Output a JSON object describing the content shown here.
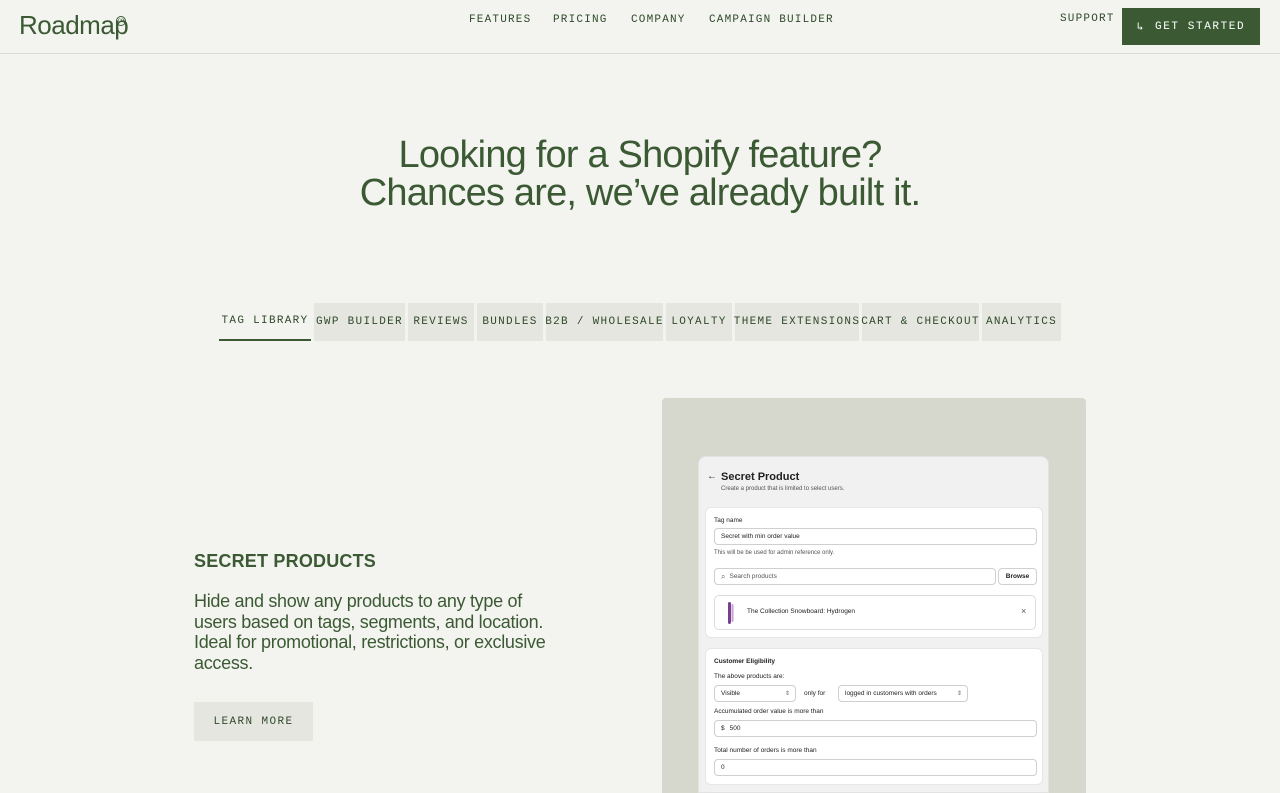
{
  "header": {
    "logo": "Roadmap",
    "logo_mark": "co",
    "nav": [
      "FEATURES",
      "PRICING",
      "COMPANY",
      "CAMPAIGN BUILDER"
    ],
    "support": "SUPPORT",
    "cta_icon": "↳",
    "cta_label": "GET STARTED"
  },
  "hero": {
    "line1": "Looking for a Shopify feature?",
    "line2": "Chances are, we’ve already built it."
  },
  "tabs": [
    "TAG LIBRARY",
    "GWP BUILDER",
    "REVIEWS",
    "BUNDLES",
    "B2B / WHOLESALE",
    "LOYALTY",
    "THEME EXTENSIONS",
    "CART & CHECKOUT",
    "ANALYTICS"
  ],
  "active_tab": "TAG LIBRARY",
  "feature": {
    "title": "SECRET PRODUCTS",
    "description": "Hide and show any products to any type of users based on tags, segments, and location. Ideal for promotional, restrictions, or exclusive access.",
    "button": "LEARN MORE"
  },
  "mock": {
    "back_icon": "←",
    "title": "Secret Product",
    "subtitle": "Create a product that is limited to select users.",
    "tag_name_label": "Tag name",
    "tag_name_value": "Secret with min order value",
    "tag_name_help": "This will be be used for admin reference only.",
    "search_icon": "⌕",
    "search_placeholder": "Search products",
    "browse": "Browse",
    "product_name": "The Collection Snowboard: Hydrogen",
    "remove_icon": "×",
    "eligibility_title": "Customer Eligibility",
    "above_label": "The above products are:",
    "visibility_value": "Visible",
    "only_for": "only for",
    "audience_value": "logged in customers with orders",
    "order_value_label": "Accumulated order value is more than",
    "currency": "$",
    "order_value": "500",
    "orders_label": "Total number of orders is more than",
    "orders_value": "0"
  },
  "colors": {
    "brand_green": "#3b5a34",
    "page_bg": "#f3f3ef",
    "tab_bg": "#e6e6e1"
  }
}
